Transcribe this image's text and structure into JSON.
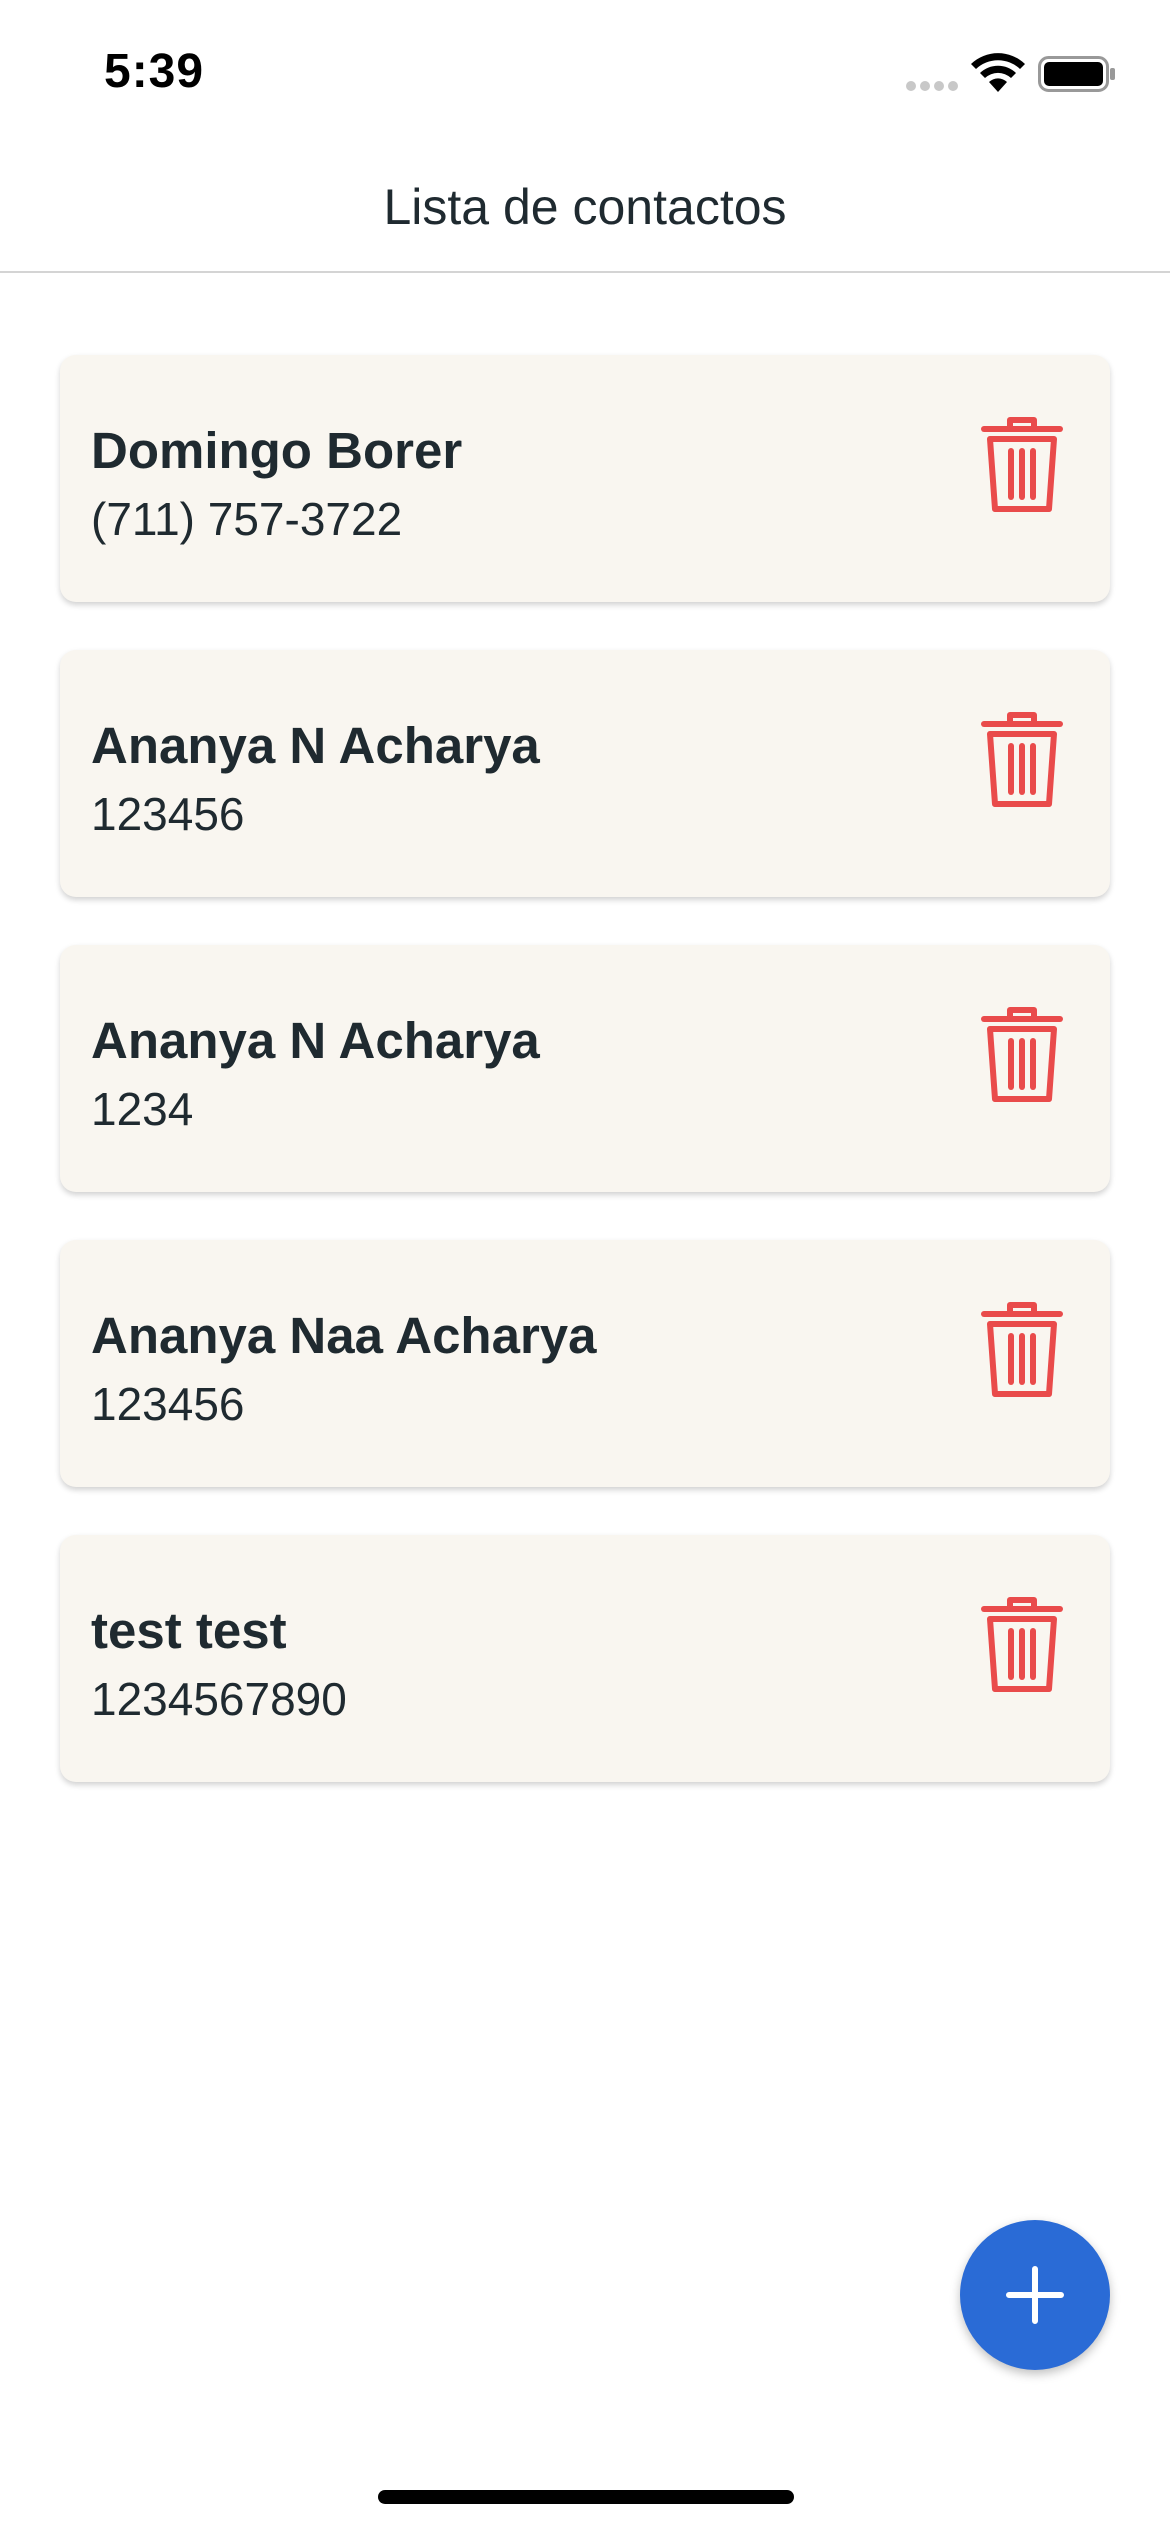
{
  "status_bar": {
    "time": "5:39",
    "icons": [
      "signal-icon",
      "wifi-icon",
      "battery-icon"
    ]
  },
  "header": {
    "title": "Lista de contactos"
  },
  "contacts": [
    {
      "name": "Domingo Borer",
      "phone": "(711) 757-3722"
    },
    {
      "name": "Ananya N Acharya",
      "phone": "123456"
    },
    {
      "name": "Ananya N Acharya",
      "phone": "1234"
    },
    {
      "name": "Ananya Naa Acharya",
      "phone": "123456"
    },
    {
      "name": "test test",
      "phone": "1234567890"
    }
  ],
  "actions": {
    "delete_icon": "trash-icon",
    "add_icon": "plus-icon"
  },
  "colors": {
    "card_background": "#f9f6f0",
    "delete_red": "#e94b4b",
    "fab_blue": "#2a6bd6",
    "text_dark": "#1f2a30"
  }
}
